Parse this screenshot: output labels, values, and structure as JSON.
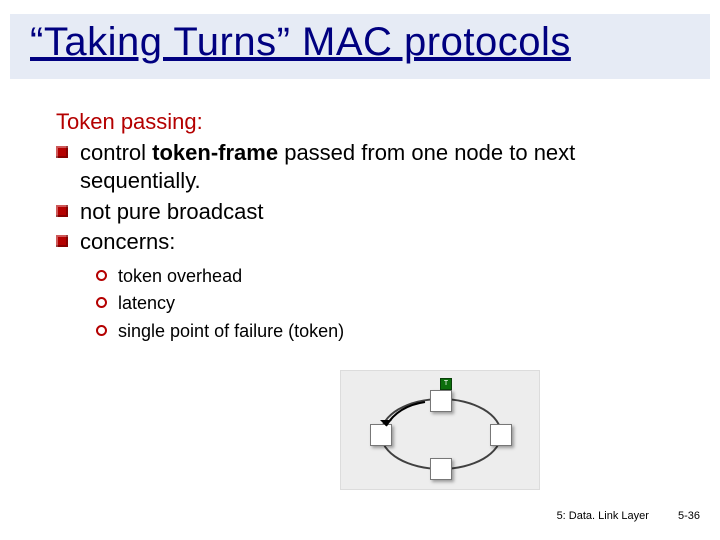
{
  "title": "“Taking Turns” MAC protocols",
  "subheading": "Token passing:",
  "bullets1": [
    {
      "pre": "control ",
      "bold": "token-frame",
      "post": " passed from one node to next sequentially."
    },
    {
      "text": "not pure broadcast"
    },
    {
      "text": "concerns:"
    }
  ],
  "bullets2": [
    "token overhead",
    "latency",
    "single point of failure (token)"
  ],
  "diagram": {
    "token_label": "T"
  },
  "footer": {
    "section": "5: Data. Link Layer",
    "page": "5-36"
  }
}
